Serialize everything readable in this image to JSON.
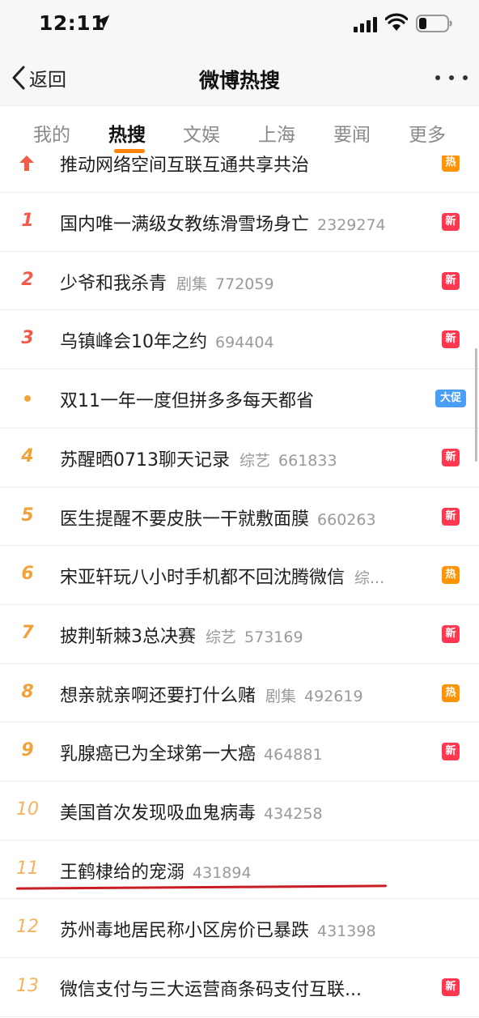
{
  "status": {
    "time": "12:11"
  },
  "nav": {
    "back_label": "返回",
    "title": "微博热搜"
  },
  "tabs": [
    {
      "label": "我的"
    },
    {
      "label": "热搜"
    },
    {
      "label": "文娱"
    },
    {
      "label": "上海"
    },
    {
      "label": "要闻"
    },
    {
      "label": "更多"
    }
  ],
  "active_tab": "热搜",
  "items": [
    {
      "rank": "",
      "rank_type": "arrow",
      "title": "推动网络空间互联互通共享共治",
      "category": "",
      "count": "",
      "badge": "热",
      "badge_type": "hot"
    },
    {
      "rank": "1",
      "rank_type": "top",
      "title": "国内唯一满级女教练滑雪场身亡",
      "category": "",
      "count": "2329274",
      "badge": "新",
      "badge_type": "new"
    },
    {
      "rank": "2",
      "rank_type": "top",
      "title": "少爷和我杀青",
      "category": "剧集",
      "count": "772059",
      "badge": "新",
      "badge_type": "new"
    },
    {
      "rank": "3",
      "rank_type": "top",
      "title": "乌镇峰会10年之约",
      "category": "",
      "count": "694404",
      "badge": "新",
      "badge_type": "new"
    },
    {
      "rank": "",
      "rank_type": "dot",
      "title": "双11一年一度但拼多多每天都省",
      "category": "",
      "count": "",
      "badge": "大促",
      "badge_type": "promo"
    },
    {
      "rank": "4",
      "rank_type": "mid",
      "title": "苏醒晒0713聊天记录",
      "category": "综艺",
      "count": "661833",
      "badge": "新",
      "badge_type": "new"
    },
    {
      "rank": "5",
      "rank_type": "mid",
      "title": "医生提醒不要皮肤一干就敷面膜",
      "category": "",
      "count": "660263",
      "badge": "新",
      "badge_type": "new"
    },
    {
      "rank": "6",
      "rank_type": "mid",
      "title": "宋亚轩玩八小时手机都不回沈腾微信",
      "category": "综...",
      "count": "",
      "badge": "热",
      "badge_type": "hot"
    },
    {
      "rank": "7",
      "rank_type": "mid",
      "title": "披荆斩棘3总决赛",
      "category": "综艺",
      "count": "573169",
      "badge": "新",
      "badge_type": "new"
    },
    {
      "rank": "8",
      "rank_type": "mid",
      "title": "想亲就亲啊还要打什么赌",
      "category": "剧集",
      "count": "492619",
      "badge": "热",
      "badge_type": "hot"
    },
    {
      "rank": "9",
      "rank_type": "mid",
      "title": "乳腺癌已为全球第一大癌",
      "category": "",
      "count": "464881",
      "badge": "新",
      "badge_type": "new"
    },
    {
      "rank": "10",
      "rank_type": "low",
      "title": "美国首次发现吸血鬼病毒",
      "category": "",
      "count": "434258",
      "badge": "",
      "badge_type": ""
    },
    {
      "rank": "11",
      "rank_type": "low",
      "title": "王鹤棣给的宠溺",
      "category": "",
      "count": "431894",
      "badge": "",
      "badge_type": ""
    },
    {
      "rank": "12",
      "rank_type": "low",
      "title": "苏州毒地居民称小区房价已暴跌",
      "category": "",
      "count": "431398",
      "badge": "",
      "badge_type": ""
    },
    {
      "rank": "13",
      "rank_type": "low",
      "title": "微信支付与三大运营商条码支付互联...",
      "category": "",
      "count": "",
      "badge": "新",
      "badge_type": "new"
    }
  ],
  "colors": {
    "accent": "#ff8200",
    "badge_new": "#ff3852",
    "badge_hot": "#ff9406",
    "badge_promo": "#4a9ef5",
    "underline_annotation": "#c81d25"
  }
}
